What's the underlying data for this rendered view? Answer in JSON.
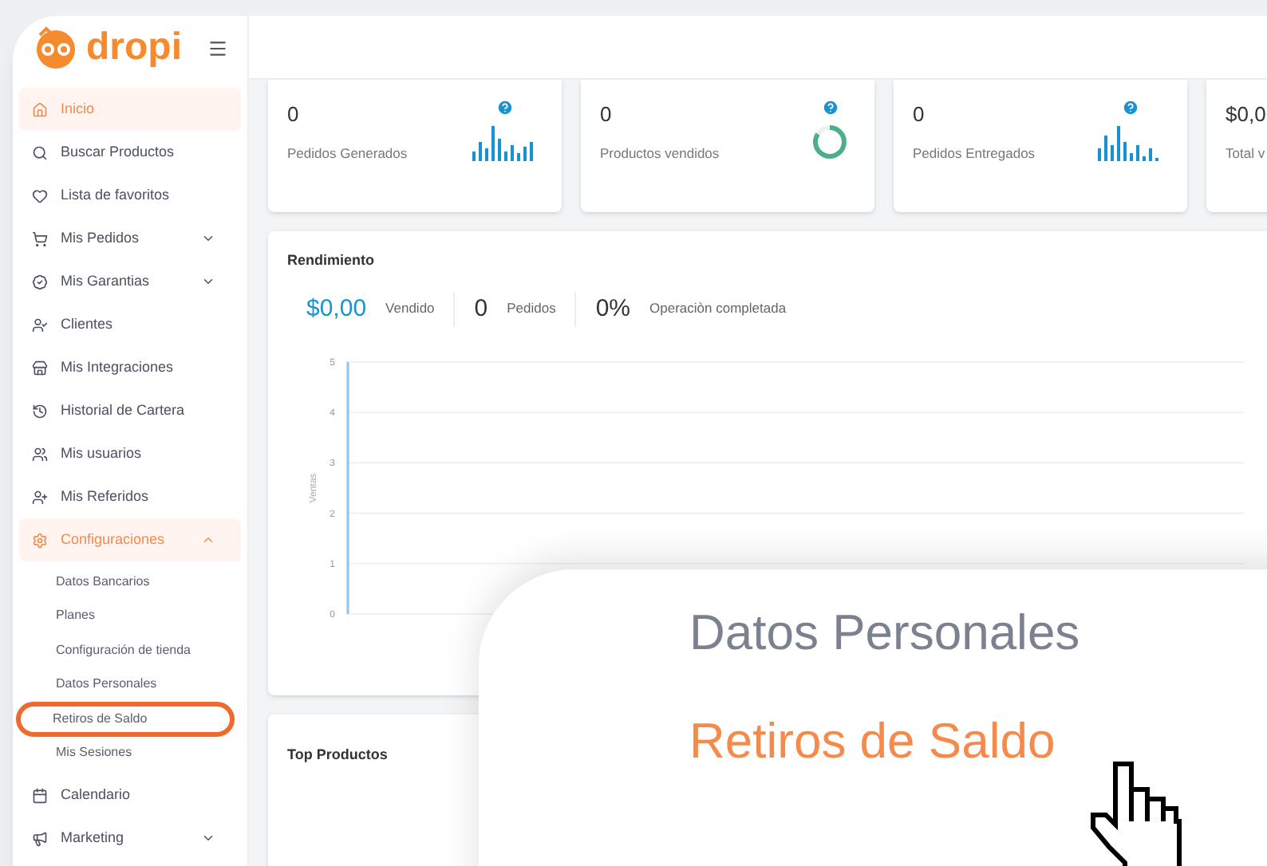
{
  "logo": {
    "text": "dropi"
  },
  "sidebar": {
    "items": [
      {
        "kind": "item",
        "label": "Inicio",
        "selected": true
      },
      {
        "kind": "item",
        "label": "Buscar Productos",
        "selected": false
      },
      {
        "kind": "item",
        "label": "Lista de favoritos",
        "selected": false
      },
      {
        "kind": "group",
        "label": "Mis Pedidos",
        "selected": false,
        "expanded": false
      },
      {
        "kind": "group",
        "label": "Mis Garantias",
        "selected": false,
        "expanded": false
      },
      {
        "kind": "item",
        "label": "Clientes",
        "selected": false
      },
      {
        "kind": "item",
        "label": "Mis Integraciones",
        "selected": false
      },
      {
        "kind": "item",
        "label": "Historial de Cartera",
        "selected": false
      },
      {
        "kind": "item",
        "label": "Mis usuarios",
        "selected": false
      },
      {
        "kind": "item",
        "label": "Mis Referidos",
        "selected": false
      },
      {
        "kind": "group",
        "label": "Configuraciones",
        "selected": true,
        "expanded": true,
        "children": [
          {
            "label": "Datos Bancarios",
            "highlighted": false
          },
          {
            "label": "Planes",
            "highlighted": false
          },
          {
            "label": "Configuración de tienda",
            "highlighted": false
          },
          {
            "label": "Datos Personales",
            "highlighted": false
          },
          {
            "label": "Retiros de Saldo",
            "highlighted": true
          },
          {
            "label": "Mis Sesiones",
            "highlighted": false
          }
        ]
      },
      {
        "kind": "item",
        "label": "Calendario",
        "selected": false
      },
      {
        "kind": "group",
        "label": "Marketing",
        "selected": false,
        "expanded": false
      }
    ]
  },
  "stats": [
    {
      "kind": "bars",
      "value": "0",
      "label": "Pedidos Generados"
    },
    {
      "kind": "donut",
      "value": "0",
      "label": "Productos vendidos"
    },
    {
      "kind": "bars",
      "value": "0",
      "label": "Pedidos Entregados"
    },
    {
      "kind": "plain",
      "value": "$0,0",
      "label": "Total v"
    }
  ],
  "performance": {
    "title": "Rendimiento",
    "metrics": [
      {
        "value": "$0,00",
        "label": "Vendido",
        "accent": true
      },
      {
        "value": "0",
        "label": "Pedidos",
        "accent": false
      },
      {
        "value": "0%",
        "label": "Operaciòn completada",
        "accent": false
      }
    ],
    "sales_chart": {
      "axis_title": "Ventas",
      "tick_labels": [
        "5",
        "4",
        "3",
        "2",
        "1",
        "0"
      ]
    }
  },
  "top_products": {
    "title": "Top Productos"
  },
  "callout": {
    "items": [
      {
        "label": "Datos Personales",
        "highlighted": false
      },
      {
        "label": "Retiros de Saldo",
        "highlighted": true
      }
    ]
  }
}
